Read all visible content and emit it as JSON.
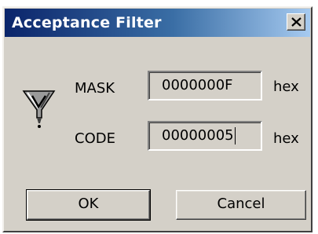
{
  "window": {
    "title": "Acceptance Filter",
    "close_glyph": "X"
  },
  "icon": {
    "name": "funnel-filter-icon"
  },
  "mask": {
    "label": "MASK",
    "value": "0000000F",
    "unit": "hex"
  },
  "code": {
    "label": "CODE",
    "value": "00000005",
    "unit": "hex"
  },
  "buttons": {
    "ok_label": "OK",
    "cancel_label": "Cancel"
  },
  "colors": {
    "dialog_face": "#d4d0c8",
    "titlebar_start": "#0a246a",
    "titlebar_end": "#a6caf0",
    "title_text": "#ffffff"
  }
}
